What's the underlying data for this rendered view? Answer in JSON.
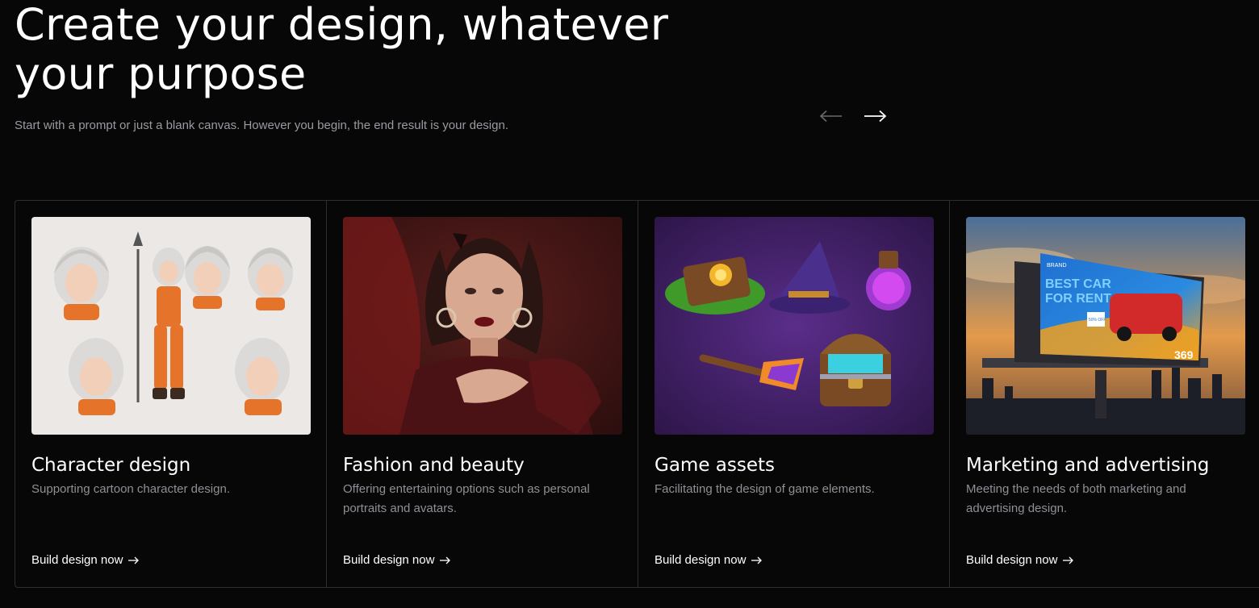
{
  "hero": {
    "title": "Create your design, whatever your purpose",
    "subtitle": "Start with a prompt or just a blank canvas. However you begin, the end result is your design."
  },
  "nav": {
    "prev_icon": "arrow-left-icon",
    "next_icon": "arrow-right-icon"
  },
  "cards": [
    {
      "title": "Character design",
      "description": "Supporting cartoon character design.",
      "cta": "Build design now",
      "image": "character-design-image"
    },
    {
      "title": "Fashion and beauty",
      "description": "Offering entertaining options such as personal portraits and avatars.",
      "cta": "Build design now",
      "image": "fashion-portrait-image"
    },
    {
      "title": "Game assets",
      "description": "Facilitating the design of game elements.",
      "cta": "Build design now",
      "image": "game-assets-image"
    },
    {
      "title": "Marketing and advertising",
      "description": "Meeting the needs of both marketing and advertising design.",
      "cta": "Build design now",
      "image": "billboard-image",
      "billboard": {
        "brand": "BRAND",
        "headline_1": "BEST CAR",
        "headline_2": "FOR RENT",
        "badge": "50% OFF",
        "price": "369"
      }
    }
  ],
  "colors": {
    "background": "#070708",
    "border": "#2e2e32",
    "muted_text": "#8f8f96"
  }
}
